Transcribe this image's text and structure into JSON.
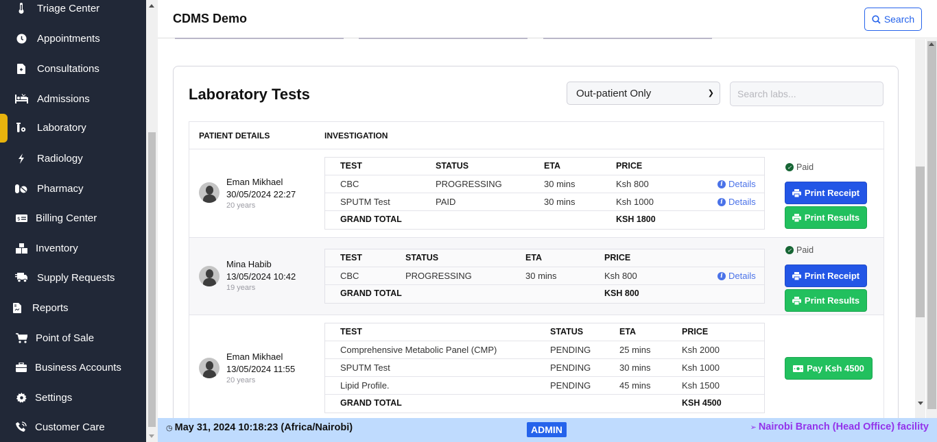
{
  "sidebar": {
    "items": [
      {
        "label": "Triage Center",
        "icon": "thermometer-icon"
      },
      {
        "label": "Appointments",
        "icon": "clock-icon"
      },
      {
        "label": "Consultations",
        "icon": "medical-file-icon"
      },
      {
        "label": "Admissions",
        "icon": "bed-icon"
      },
      {
        "label": "Laboratory",
        "icon": "lab-icon",
        "active": true
      },
      {
        "label": "Radiology",
        "icon": "bolt-icon"
      },
      {
        "label": "Pharmacy",
        "icon": "pills-icon"
      },
      {
        "label": "Billing Center",
        "icon": "money-check-icon"
      },
      {
        "label": "Inventory",
        "icon": "boxes-icon"
      },
      {
        "label": "Supply Requests",
        "icon": "truck-icon"
      },
      {
        "label": "Reports",
        "icon": "report-file-icon"
      },
      {
        "label": "Point of Sale",
        "icon": "cart-icon"
      },
      {
        "label": "Business Accounts",
        "icon": "briefcase-icon"
      },
      {
        "label": "Settings",
        "icon": "gear-icon"
      },
      {
        "label": "Customer Care",
        "icon": "phone-icon"
      }
    ],
    "active_color": "#e8b30d"
  },
  "header": {
    "title": "CDMS Demo",
    "search_label": "Search"
  },
  "lab": {
    "title": "Laboratory Tests",
    "filter_selected": "Out-patient Only",
    "search_placeholder": "Search labs...",
    "columns": {
      "patient": "PATIENT DETAILS",
      "investigation": "INVESTIGATION"
    },
    "inv_columns": {
      "test": "TEST",
      "status": "STATUS",
      "eta": "ETA",
      "price": "PRICE"
    },
    "grand_total_label": "GRAND TOTAL",
    "details_label": "Details",
    "rows": [
      {
        "name": "Eman Mikhael",
        "datetime": "30/05/2024 22:27",
        "age": "20 years",
        "tests": [
          {
            "test": "CBC",
            "status": "PROGRESSING",
            "eta": "30 mins",
            "price": "Ksh 800"
          },
          {
            "test": "SPUTM Test",
            "status": "PAID",
            "eta": "30 mins",
            "price": "Ksh 1000"
          }
        ],
        "grand_total": "KSH 1800",
        "payment_status": "Paid",
        "print_receipt": "Print Receipt",
        "print_results": "Print Results"
      },
      {
        "name": "Mina Habib",
        "datetime": "13/05/2024 10:42",
        "age": "19 years",
        "tests": [
          {
            "test": "CBC",
            "status": "PROGRESSING",
            "eta": "30 mins",
            "price": "Ksh 800"
          }
        ],
        "grand_total": "KSH 800",
        "payment_status": "Paid",
        "print_receipt": "Print Receipt",
        "print_results": "Print Results"
      },
      {
        "name": "Eman Mikhael",
        "datetime": "13/05/2024 11:55",
        "age": "20 years",
        "tests": [
          {
            "test": "Comprehensive Metabolic Panel (CMP)",
            "status": "PENDING",
            "eta": "25 mins",
            "price": "Ksh 2000"
          },
          {
            "test": "SPUTM Test",
            "status": "PENDING",
            "eta": "30 mins",
            "price": "Ksh 1000"
          },
          {
            "test": "Lipid Profile.",
            "status": "PENDING",
            "eta": "45 mins",
            "price": "Ksh 1500"
          }
        ],
        "grand_total": "KSH 4500",
        "pay_label": "Pay Ksh 4500"
      }
    ]
  },
  "footer": {
    "datetime": "May 31, 2024 10:18:23 (Africa/Nairobi)",
    "role": "ADMIN",
    "facility": "Nairobi Branch (Head Office) facility"
  },
  "colors": {
    "sidebar_bg": "#212837",
    "primary": "#2563eb",
    "success": "#22c05e",
    "footer_bg": "#bfdbfe",
    "facility_text": "#9333ea"
  }
}
